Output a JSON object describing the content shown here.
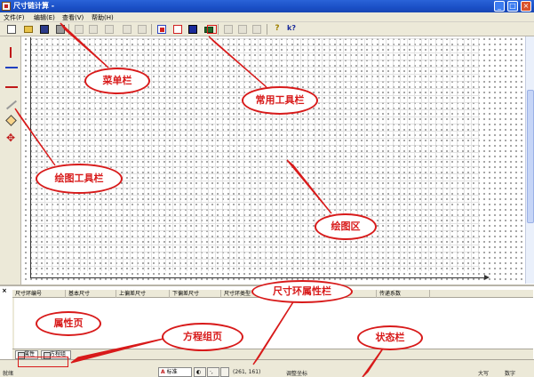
{
  "window": {
    "title": "尺寸链计算 -"
  },
  "menu": {
    "items": [
      "文件(F)",
      "编辑(E)",
      "查看(V)",
      "帮助(H)"
    ]
  },
  "panel": {
    "columns": [
      "尺寸环编号",
      "基本尺寸",
      "上偏差尺寸",
      "下偏差尺寸",
      "尺寸环类型",
      "",
      "属性",
      "传递系数"
    ],
    "tabs": [
      "属性",
      "方程组"
    ]
  },
  "status": {
    "ready": "就绪",
    "mode": "标准",
    "coords": "(261, 161)",
    "info": "调整坐标",
    "right1": "大写",
    "right2": "数字"
  },
  "annotations": {
    "menubar": "菜单栏",
    "toolbar": "常用工具栏",
    "draw_toolbar": "绘图工具栏",
    "draw_area": "绘图区",
    "prop_bar": "尺寸环属性栏",
    "prop_page": "属性页",
    "equation_page": "方程组页",
    "status_bar": "状态栏"
  },
  "colors": {
    "annotation": "#d81a1a",
    "titlebar": "#1a4fc6",
    "chrome": "#ece9d8"
  }
}
